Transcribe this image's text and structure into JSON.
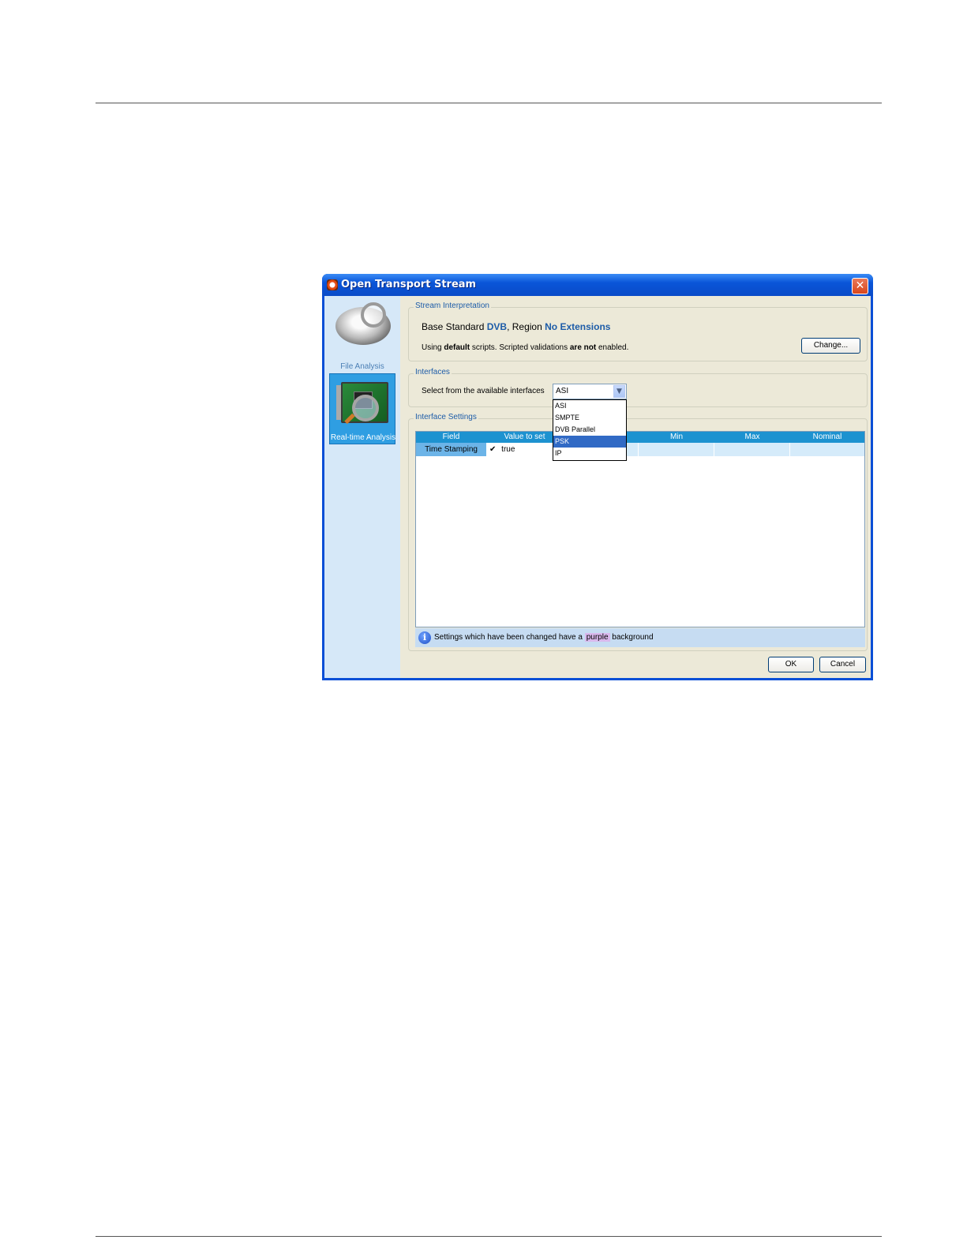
{
  "window": {
    "title": "Open Transport Stream",
    "close_glyph": "✕"
  },
  "leftnav": {
    "items": [
      {
        "label": "File Analysis",
        "icon": "disc-magnifier-icon"
      },
      {
        "label": "Real-time Analysis",
        "icon": "card-magnifier-icon"
      }
    ]
  },
  "stream_interpretation": {
    "legend": "Stream Interpretation",
    "line1_prefix": "Base Standard ",
    "base_standard": "DVB",
    "line1_mid": ", Region ",
    "region": "No Extensions",
    "line2_prefix": "Using ",
    "scripts": "default",
    "line2_mid": " scripts. Scripted validations ",
    "validations": "are not",
    "line2_suffix": " enabled.",
    "change_label": "Change..."
  },
  "interfaces": {
    "legend": "Interfaces",
    "prompt": "Select from the available interfaces",
    "selected": "ASI",
    "options": [
      "ASI",
      "SMPTE",
      "DVB Parallel",
      "PSK",
      "IP"
    ],
    "highlighted": "PSK"
  },
  "interface_settings": {
    "legend": "Interface Settings",
    "columns": [
      "Field",
      "Value to set",
      "Min",
      "Max",
      "Nominal"
    ],
    "rows": [
      {
        "field": "Time Stamping",
        "check": "✔",
        "value": "true"
      }
    ],
    "info_prefix": "Settings which have been changed have a ",
    "info_highlight": "purple",
    "info_suffix": " background"
  },
  "buttons": {
    "ok": "OK",
    "cancel": "Cancel"
  },
  "colors": {
    "accent": "#1d5ca8",
    "header": "#1d92d0",
    "selection": "#316ac5",
    "changed": "#d9b8ec"
  }
}
